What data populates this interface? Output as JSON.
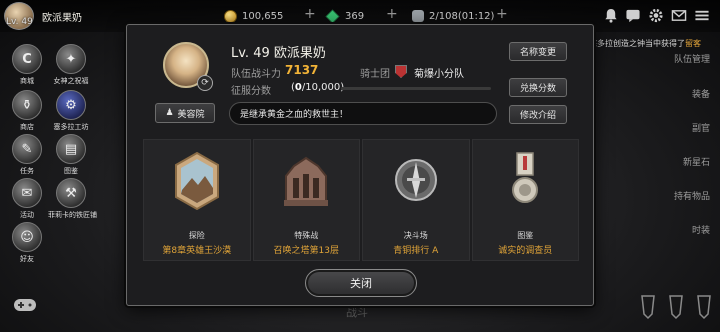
{
  "player": {
    "level": "Lv. 49",
    "name": "欧派果奶"
  },
  "resources": {
    "gold": "100,655",
    "gems": "369",
    "inventory": "2/108(01:12)"
  },
  "notice": {
    "prefix": "魅魔在塞多拉创造之钟当中获得了",
    "item": "留客"
  },
  "left_menu": [
    {
      "label": "商城",
      "glyph": "C"
    },
    {
      "label": "女神之祝福",
      "glyph": "✦"
    },
    {
      "label": "商店",
      "glyph": "⚱"
    },
    {
      "label": "塞多拉工坊",
      "glyph": "⚙"
    },
    {
      "label": "任务",
      "glyph": "✎"
    },
    {
      "label": "图鉴",
      "glyph": "▤"
    },
    {
      "label": "活动",
      "glyph": "✉"
    },
    {
      "label": "菲莉卡的铁匠铺",
      "glyph": "⚒"
    },
    {
      "label": "好友",
      "glyph": "☺"
    }
  ],
  "right_menu": [
    {
      "label": "队伍管理"
    },
    {
      "label": "装备"
    },
    {
      "label": "副官"
    },
    {
      "label": "新星石"
    },
    {
      "label": "持有物品"
    },
    {
      "label": "时装"
    }
  ],
  "dialog": {
    "name": "Lv. 49 欧派果奶",
    "power_label": "队伍战斗力",
    "power_value": "7137",
    "guild_label": "骑士团",
    "guild_name": "菊爆小分队",
    "score_label": "征服分数",
    "score_value": "0",
    "score_total": "/10,000",
    "buttons": {
      "rename": "名称变更",
      "exchange": "兑换分数",
      "edit_motto": "修改介绍",
      "beauty": "美容院",
      "close": "关闭"
    },
    "motto": "是继承黄金之血的救世主！",
    "cards": [
      {
        "category": "探险",
        "value": "第8章英雄王沙漠"
      },
      {
        "category": "特殊战",
        "value": "召唤之塔第13层"
      },
      {
        "category": "决斗场",
        "value": "青铜排行 A"
      },
      {
        "category": "图鉴",
        "value": "诚实的调查员"
      }
    ]
  },
  "bottom_hint": "战斗",
  "colors": {
    "accent_gold": "#f2b337",
    "value_orange": "#e0a438",
    "panel": "#1d1d1f"
  }
}
